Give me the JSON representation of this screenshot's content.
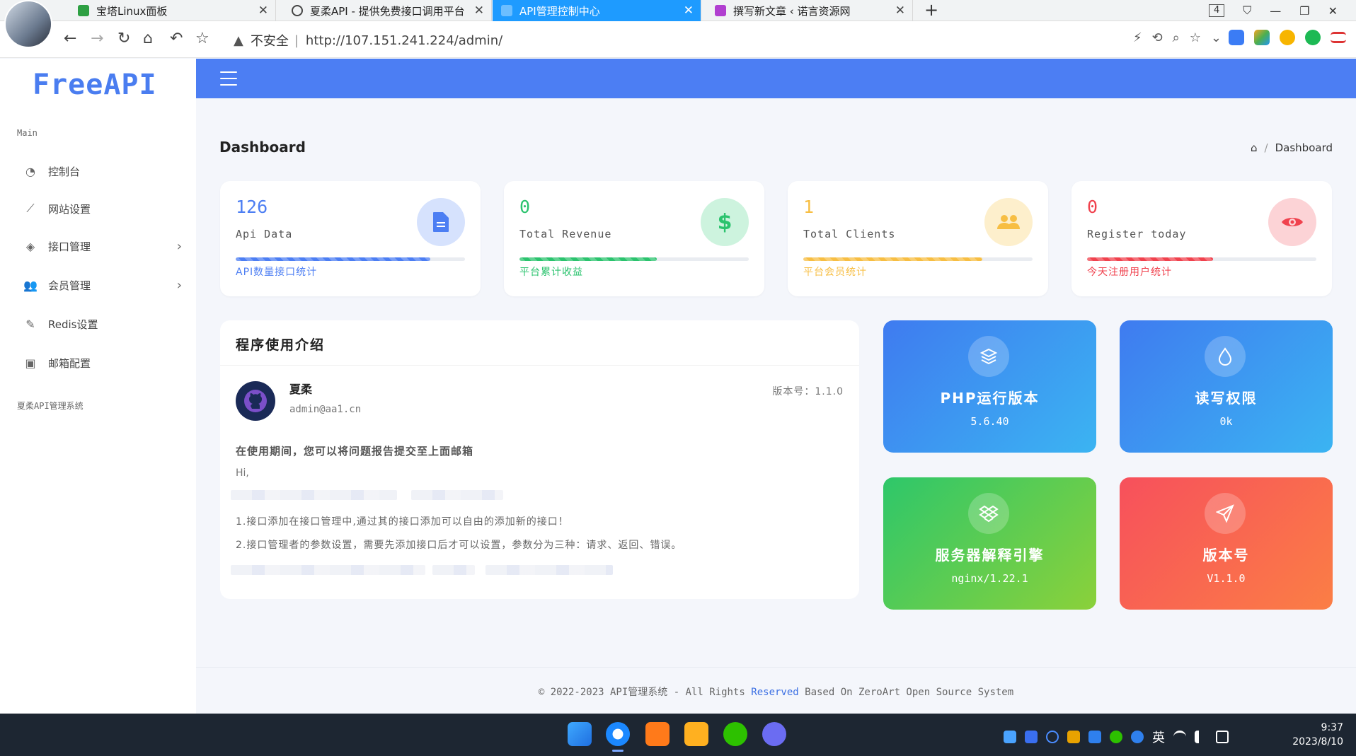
{
  "browser": {
    "tabs": [
      {
        "title": "宝塔Linux面板",
        "active": false
      },
      {
        "title": "夏柔API - 提供免费接口调用平台",
        "active": false
      },
      {
        "title": "API管理控制中心",
        "active": true
      },
      {
        "title": "撰写新文章 ‹ 诺言资源网",
        "active": false
      }
    ],
    "tab_count": "4",
    "insecure_label": "不安全",
    "url": "http://107.151.241.224/admin/"
  },
  "sidebar": {
    "logo": "FreeAPI",
    "section_main": "Main",
    "items": [
      {
        "label": "控制台",
        "icon": "dashboard-icon",
        "has_children": false
      },
      {
        "label": "网站设置",
        "icon": "trend-icon",
        "has_children": false
      },
      {
        "label": "接口管理",
        "icon": "layers-icon",
        "has_children": true
      },
      {
        "label": "会员管理",
        "icon": "users-icon",
        "has_children": true
      },
      {
        "label": "Redis设置",
        "icon": "feather-icon",
        "has_children": false
      },
      {
        "label": "邮箱配置",
        "icon": "mailbox-icon",
        "has_children": false
      }
    ],
    "section_footer": "夏柔API管理系统"
  },
  "page": {
    "title": "Dashboard",
    "breadcrumb": "Dashboard"
  },
  "stats": [
    {
      "value": "126",
      "label": "Api Data",
      "desc": "API数量接口统计",
      "progress": 0.85,
      "color": "#4c7ef3",
      "circle_bg": "#d6e2fd",
      "icon": "document-icon"
    },
    {
      "value": "0",
      "label": "Total Revenue",
      "desc": "平台累计收益",
      "progress": 0.6,
      "color": "#2bc36e",
      "circle_bg": "#cdf3de",
      "icon": "dollar-icon"
    },
    {
      "value": "1",
      "label": "Total Clients",
      "desc": "平台会员统计",
      "progress": 0.78,
      "color": "#f7be43",
      "circle_bg": "#fdefcc",
      "icon": "users-icon"
    },
    {
      "value": "0",
      "label": "Register today",
      "desc": "今天注册用户统计",
      "progress": 0.55,
      "color": "#f0424e",
      "circle_bg": "#fcd3d6",
      "icon": "eye-icon"
    }
  ],
  "intro": {
    "title": "程序使用介绍",
    "author": "夏柔",
    "email": "admin@aa1.cn",
    "version_label": "版本号：1.1.0",
    "headline": "在使用期间，您可以将问题报告提交至上面邮箱",
    "greeting": "Hi,",
    "lines": [
      "1.接口添加在接口管理中,通过其的接口添加可以自由的添加新的接口！",
      "2.接口管理者的参数设置，需要先添加接口后才可以设置，参数分为三种：请求、返回、错误。"
    ]
  },
  "tiles": [
    {
      "title": "PHP运行版本",
      "value": "5.6.40",
      "icon": "layers-icon",
      "gradient": [
        "#3f7bf0",
        "#3bb4f2"
      ]
    },
    {
      "title": "读写权限",
      "value": "0k",
      "icon": "droplet-icon",
      "gradient": [
        "#3f7bf0",
        "#3bb4f2"
      ]
    },
    {
      "title": "服务器解释引擎",
      "value": "nginx/1.22.1",
      "icon": "dropbox-icon",
      "gradient": [
        "#2ec76a",
        "#8bd13a"
      ]
    },
    {
      "title": "版本号",
      "value": "V1.1.0",
      "icon": "send-icon",
      "gradient": [
        "#f7505c",
        "#fb7e45"
      ]
    }
  ],
  "footer": {
    "prefix": "©  2022-2023 API管理系统 - All Rights ",
    "highlight": "Reserved",
    "suffix": " Based On ZeroArt Open Source System"
  },
  "taskbar": {
    "ime": "英",
    "time": "9:37",
    "date": "2023/8/10"
  }
}
